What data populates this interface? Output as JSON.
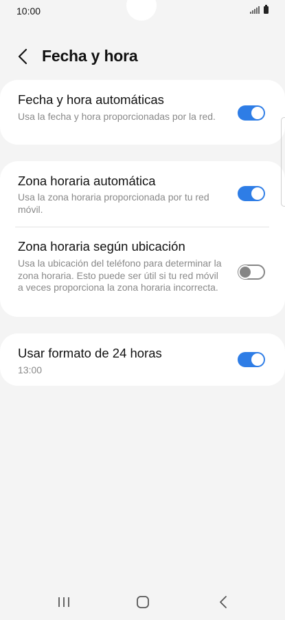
{
  "status_bar": {
    "time": "10:00"
  },
  "header": {
    "title": "Fecha y hora"
  },
  "settings": {
    "auto_datetime": {
      "title": "Fecha y hora automáticas",
      "subtitle": "Usa la fecha y hora proporcionadas por la red.",
      "enabled": true
    },
    "auto_timezone": {
      "title": "Zona horaria automática",
      "subtitle": "Usa la zona horaria proporcionada por tu red móvil.",
      "enabled": true
    },
    "location_timezone": {
      "title": "Zona horaria según ubicación",
      "subtitle": "Usa la ubicación del teléfono para determinar la zona horaria. Esto puede ser útil si tu red móvil a veces proporciona la zona horaria incorrecta.",
      "enabled": false
    },
    "format_24h": {
      "title": "Usar formato de 24 horas",
      "subtitle": "13:00",
      "enabled": true
    }
  },
  "colors": {
    "toggle_on": "#2e7de6",
    "toggle_off": "#858585",
    "background": "#f4f4f4",
    "card": "#ffffff"
  },
  "icons": {
    "back": "chevron-left-icon",
    "recents": "recents-icon",
    "home": "home-icon",
    "nav_back": "nav-back-icon"
  }
}
